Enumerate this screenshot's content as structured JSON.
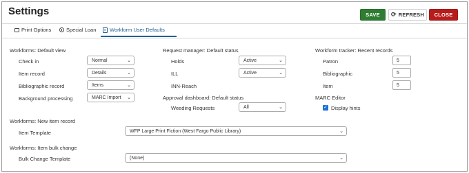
{
  "header": {
    "title": "Settings",
    "save_label": "SAVE",
    "refresh_label": "REFRESH",
    "close_label": "CLOSE"
  },
  "tabs": [
    {
      "label": "Print Options",
      "icon": "printer-icon"
    },
    {
      "label": "Special Loan",
      "icon": "clock-icon"
    },
    {
      "label": "Workform User Defaults",
      "icon": "document-icon",
      "active": true
    }
  ],
  "workforms_default_view": {
    "heading": "Workforms: Default view",
    "rows": [
      {
        "label": "Check in",
        "value": "Normal"
      },
      {
        "label": "Item record",
        "value": "Details"
      },
      {
        "label": "Bibliographic record",
        "value": "Items"
      },
      {
        "label": "Background processing",
        "value": "MARC Import"
      }
    ]
  },
  "request_manager": {
    "heading": "Request manager: Default status",
    "rows": [
      {
        "label": "Holds",
        "value": "Active"
      },
      {
        "label": "ILL",
        "value": "Active"
      },
      {
        "label": "INN-Reach"
      }
    ]
  },
  "approval_dashboard": {
    "heading": "Approval dashboard: Default status",
    "rows": [
      {
        "label": "Weeding Requests",
        "value": "All"
      }
    ]
  },
  "workform_tracker": {
    "heading": "Workform tracker: Recent records",
    "rows": [
      {
        "label": "Patron",
        "value": "5"
      },
      {
        "label": "Bibliographic",
        "value": "5"
      },
      {
        "label": "Item",
        "value": "5"
      }
    ]
  },
  "marc_editor": {
    "heading": "MARC Editor",
    "display_hints_label": "Display hints",
    "display_hints_checked": true
  },
  "new_item_record": {
    "heading": "Workforms: New item record",
    "label": "Item Template",
    "value": "WFP Large Print Fiction (West Fargo Public Library)"
  },
  "item_bulk_change": {
    "heading": "Workforms: Item bulk change",
    "label": "Bulk Change Template",
    "value": "(None)"
  },
  "colors": {
    "save": "#2e7d32",
    "close": "#b71c1c",
    "active_tab": "#1f5f95",
    "checkbox": "#1e6fd9"
  }
}
